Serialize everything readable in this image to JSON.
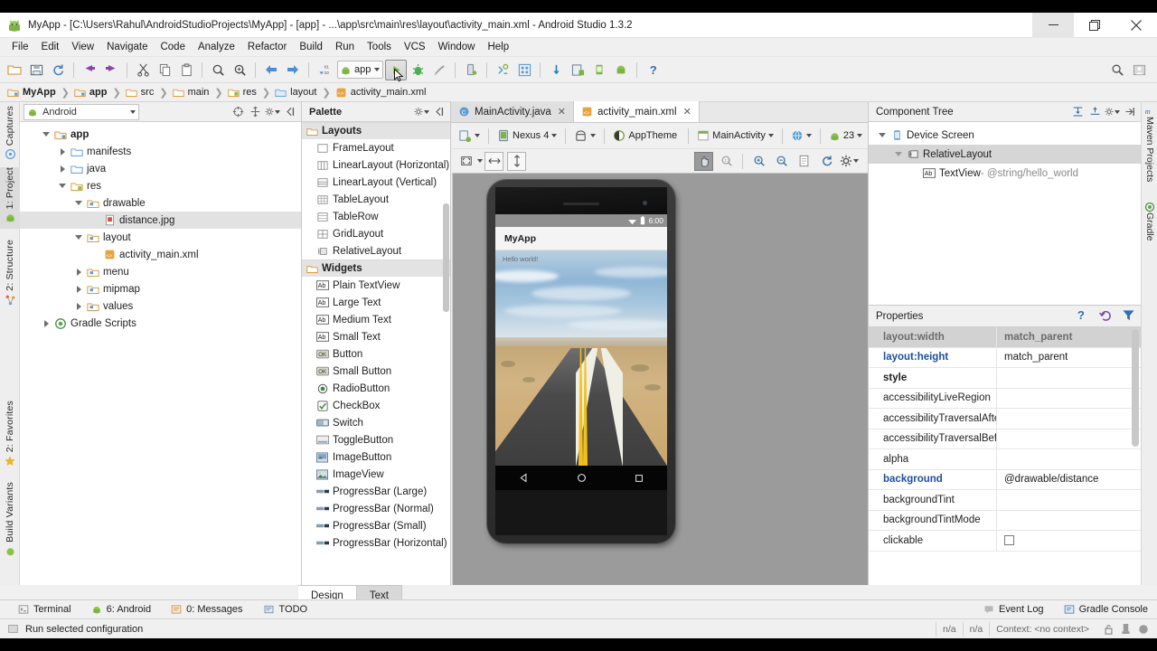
{
  "window": {
    "title": "MyApp - [C:\\Users\\Rahul\\AndroidStudioProjects\\MyApp] - [app] - ...\\app\\src\\main\\res\\layout\\activity_main.xml - Android Studio 1.3.2",
    "minimize": "minimize-icon",
    "maximize": "restore-icon",
    "close": "close-icon"
  },
  "menubar": [
    {
      "label": "File"
    },
    {
      "label": "Edit"
    },
    {
      "label": "View"
    },
    {
      "label": "Navigate"
    },
    {
      "label": "Code"
    },
    {
      "label": "Analyze"
    },
    {
      "label": "Refactor"
    },
    {
      "label": "Build"
    },
    {
      "label": "Run"
    },
    {
      "label": "Tools"
    },
    {
      "label": "VCS"
    },
    {
      "label": "Window"
    },
    {
      "label": "Help"
    }
  ],
  "toolbar": {
    "module_chip": "app",
    "icons": [
      "open-folder-icon",
      "save-all-icon",
      "sync-icon",
      "undo-icon",
      "redo-icon",
      "cut-icon",
      "copy-icon",
      "paste-icon",
      "find-icon",
      "find-replace-icon",
      "back-icon",
      "forward-icon",
      "sort-icon"
    ],
    "run_icon": "run-button-icon",
    "after_run": [
      "debug-icon",
      "run-coverage-icon",
      "android-device-monitor-icon",
      "sdk-manager-icon",
      "avd-manager-icon",
      "sync-gradle-icon",
      "project-structure-icon",
      "help-icon"
    ],
    "right_icons": [
      "search-everywhere-icon",
      "layout-icon"
    ]
  },
  "breadcrumb": [
    {
      "label": "MyApp",
      "icon": "module-icon",
      "bold": true
    },
    {
      "label": "app",
      "icon": "module-icon",
      "bold": true
    },
    {
      "label": "src",
      "icon": "folder-icon",
      "bold": false
    },
    {
      "label": "main",
      "icon": "folder-icon",
      "bold": false
    },
    {
      "label": "res",
      "icon": "res-folder-icon",
      "bold": false
    },
    {
      "label": "layout",
      "icon": "layout-folder-icon",
      "bold": false
    },
    {
      "label": "activity_main.xml",
      "icon": "xml-file-icon",
      "bold": false
    }
  ],
  "left_rail": [
    {
      "label": "Captures",
      "icon": "captures-icon",
      "active": false
    },
    {
      "label": "1: Project",
      "icon": "project-icon",
      "active": true
    },
    {
      "label": "2: Structure",
      "icon": "structure-icon",
      "active": false
    },
    {
      "label": "2: Favorites",
      "icon": "favorites-star-icon",
      "active": false
    },
    {
      "label": "Build Variants",
      "icon": "build-variants-icon",
      "active": false
    }
  ],
  "right_rail": [
    {
      "label": "Maven Projects",
      "icon": "maven-icon"
    },
    {
      "label": "Gradle",
      "icon": "gradle-icon"
    }
  ],
  "project_panel": {
    "selector_value": "Android",
    "selector_icon": "android-icon",
    "header_icons": [
      "collapse-target-icon",
      "expand-all-icon",
      "settings-gear-icon",
      "hide-panel-icon"
    ],
    "tree": [
      {
        "label": "app",
        "indent": 0,
        "icon": "module-icon",
        "arrow": "open",
        "bold": true,
        "selected": false
      },
      {
        "label": "manifests",
        "indent": 1,
        "icon": "folder-blue-icon",
        "arrow": "closed",
        "bold": false,
        "selected": false
      },
      {
        "label": "java",
        "indent": 1,
        "icon": "folder-blue-icon",
        "arrow": "closed",
        "bold": false,
        "selected": false
      },
      {
        "label": "res",
        "indent": 1,
        "icon": "res-folder-icon",
        "arrow": "open",
        "bold": false,
        "selected": false
      },
      {
        "label": "drawable",
        "indent": 2,
        "icon": "folder-res-icon",
        "arrow": "open",
        "bold": false,
        "selected": false
      },
      {
        "label": "distance.jpg",
        "indent": 3,
        "icon": "image-file-icon",
        "arrow": "none",
        "bold": false,
        "selected": true
      },
      {
        "label": "layout",
        "indent": 2,
        "icon": "folder-res-icon",
        "arrow": "open",
        "bold": false,
        "selected": false
      },
      {
        "label": "activity_main.xml",
        "indent": 3,
        "icon": "xml-file-icon",
        "arrow": "none",
        "bold": false,
        "selected": false
      },
      {
        "label": "menu",
        "indent": 2,
        "icon": "folder-res-icon",
        "arrow": "closed",
        "bold": false,
        "selected": false
      },
      {
        "label": "mipmap",
        "indent": 2,
        "icon": "folder-res-icon",
        "arrow": "closed",
        "bold": false,
        "selected": false
      },
      {
        "label": "values",
        "indent": 2,
        "icon": "folder-res-icon",
        "arrow": "closed",
        "bold": false,
        "selected": false
      },
      {
        "label": "Gradle Scripts",
        "indent": 0,
        "icon": "gradle-icon",
        "arrow": "closed",
        "bold": false,
        "selected": false
      }
    ]
  },
  "palette": {
    "title": "Palette",
    "header_icons": [
      "settings-gear-icon",
      "hide-panel-icon"
    ],
    "groups": [
      {
        "name": "Layouts",
        "items": [
          {
            "label": "FrameLayout",
            "icon": "frame-layout-icon"
          },
          {
            "label": "LinearLayout (Horizontal)",
            "icon": "linear-layout-horizontal-icon"
          },
          {
            "label": "LinearLayout (Vertical)",
            "icon": "linear-layout-vertical-icon"
          },
          {
            "label": "TableLayout",
            "icon": "table-layout-icon"
          },
          {
            "label": "TableRow",
            "icon": "table-row-icon"
          },
          {
            "label": "GridLayout",
            "icon": "grid-layout-icon"
          },
          {
            "label": "RelativeLayout",
            "icon": "relative-layout-icon"
          }
        ]
      },
      {
        "name": "Widgets",
        "items": [
          {
            "label": "Plain TextView",
            "icon": "textview-icon"
          },
          {
            "label": "Large Text",
            "icon": "textview-icon"
          },
          {
            "label": "Medium Text",
            "icon": "textview-icon"
          },
          {
            "label": "Small Text",
            "icon": "textview-icon"
          },
          {
            "label": "Button",
            "icon": "button-icon"
          },
          {
            "label": "Small Button",
            "icon": "button-icon"
          },
          {
            "label": "RadioButton",
            "icon": "radio-button-icon"
          },
          {
            "label": "CheckBox",
            "icon": "checkbox-icon"
          },
          {
            "label": "Switch",
            "icon": "switch-icon"
          },
          {
            "label": "ToggleButton",
            "icon": "toggle-button-icon"
          },
          {
            "label": "ImageButton",
            "icon": "image-button-icon"
          },
          {
            "label": "ImageView",
            "icon": "image-view-icon"
          },
          {
            "label": "ProgressBar (Large)",
            "icon": "progress-bar-icon"
          },
          {
            "label": "ProgressBar (Normal)",
            "icon": "progress-bar-icon"
          },
          {
            "label": "ProgressBar (Small)",
            "icon": "progress-bar-icon"
          },
          {
            "label": "ProgressBar (Horizontal)",
            "icon": "progress-bar-icon"
          }
        ]
      }
    ]
  },
  "editor_tabs": [
    {
      "label": "MainActivity.java",
      "icon": "java-class-icon",
      "active": false
    },
    {
      "label": "activity_main.xml",
      "icon": "xml-file-icon",
      "active": true
    }
  ],
  "preview_toolbar": {
    "row1": [
      {
        "label": "",
        "icon": "device-config-icon",
        "caret": true
      },
      {
        "label": "Nexus 4",
        "icon": "device-icon",
        "caret": true
      },
      {
        "label": "",
        "icon": "orientation-icon",
        "caret": true
      },
      {
        "label": "AppTheme",
        "icon": "theme-icon",
        "caret": false
      },
      {
        "label": "MainActivity",
        "icon": "activity-icon",
        "caret": true
      },
      {
        "label": "",
        "icon": "locale-globe-icon",
        "caret": true
      },
      {
        "label": "23",
        "icon": "android-api-icon",
        "caret": true
      }
    ],
    "row2_left": [
      {
        "icon": "zoom-to-fit-icon",
        "caret": true
      },
      {
        "icon": "fit-width-icon",
        "caret": false
      },
      {
        "icon": "fit-height-icon",
        "caret": false
      }
    ],
    "row2_right": [
      {
        "icon": "pan-hand-icon",
        "active": true
      },
      {
        "icon": "zoom-actual-icon",
        "active": false
      },
      {
        "icon": "zoom-in-icon",
        "active": false
      },
      {
        "icon": "zoom-out-icon",
        "active": false
      },
      {
        "icon": "screenshot-icon",
        "active": false
      },
      {
        "icon": "refresh-icon",
        "active": false
      },
      {
        "icon": "settings-gear-icon",
        "active": false
      }
    ]
  },
  "device_preview": {
    "device": "Nexus 4",
    "status_clock": "6:00",
    "status_icons": [
      "wifi-icon",
      "battery-icon"
    ],
    "app_title": "MyApp",
    "hello_text": "Hello world!",
    "nav_buttons": [
      "back-nav-icon",
      "home-nav-icon",
      "recents-nav-icon"
    ],
    "background_image": "distance.jpg"
  },
  "component_tree": {
    "title": "Component Tree",
    "header_icons": [
      "expand-all-icon",
      "collapse-all-icon",
      "settings-gear-icon",
      "hide-panel-icon"
    ],
    "rows": [
      {
        "label": "Device Screen",
        "indent": 0,
        "icon": "device-screen-icon",
        "arrow": "open",
        "selected": false,
        "suffix": ""
      },
      {
        "label": "RelativeLayout",
        "indent": 1,
        "icon": "relative-layout-icon",
        "arrow": "open",
        "selected": true,
        "suffix": ""
      },
      {
        "label": "TextView",
        "indent": 2,
        "icon": "textview-icon",
        "arrow": "none",
        "selected": false,
        "suffix": " - @string/hello_world"
      }
    ]
  },
  "properties": {
    "title": "Properties",
    "header_icons": [
      "help-question-icon",
      "restore-default-icon",
      "filter-funnel-icon"
    ],
    "rows": [
      {
        "name": "layout:width",
        "value": "match_parent",
        "style": "selected"
      },
      {
        "name": "layout:height",
        "value": "match_parent",
        "style": "link"
      },
      {
        "name": "style",
        "value": "",
        "style": "bold"
      },
      {
        "name": "accessibilityLiveRegion",
        "value": "",
        "style": "normal"
      },
      {
        "name": "accessibilityTraversalAfte",
        "value": "",
        "style": "normal"
      },
      {
        "name": "accessibilityTraversalBefc",
        "value": "",
        "style": "normal"
      },
      {
        "name": "alpha",
        "value": "",
        "style": "normal"
      },
      {
        "name": "background",
        "value": "@drawable/distance",
        "style": "link"
      },
      {
        "name": "backgroundTint",
        "value": "",
        "style": "normal"
      },
      {
        "name": "backgroundTintMode",
        "value": "",
        "style": "normal"
      },
      {
        "name": "clickable",
        "value": "",
        "style": "checkbox"
      }
    ]
  },
  "design_tabs": [
    {
      "label": "Design",
      "active": false
    },
    {
      "label": "Text",
      "active": true
    }
  ],
  "status_bar": {
    "tools": [
      {
        "label": "Terminal",
        "icon": "terminal-icon"
      },
      {
        "label": "6: Android",
        "icon": "android-icon"
      },
      {
        "label": "0: Messages",
        "icon": "messages-icon"
      },
      {
        "label": "TODO",
        "icon": "todo-icon"
      }
    ],
    "right_tools": [
      {
        "label": "Event Log",
        "icon": "event-log-icon"
      },
      {
        "label": "Gradle Console",
        "icon": "gradle-console-icon"
      }
    ]
  },
  "bottom_bar": {
    "message": "Run selected configuration",
    "message_icon": "run-config-icon",
    "cells": [
      "n/a",
      "n/a",
      "Context: <no context>"
    ],
    "icons": [
      "lock-icon",
      "memory-icon",
      "background-tasks-icon"
    ]
  },
  "colors": {
    "accent_blue": "#1a4f9c",
    "panel_bg": "#f0f0f0",
    "canvas_bg": "#9b9b9b",
    "selection": "#d6d6d6",
    "android_green": "#8bc34a"
  }
}
